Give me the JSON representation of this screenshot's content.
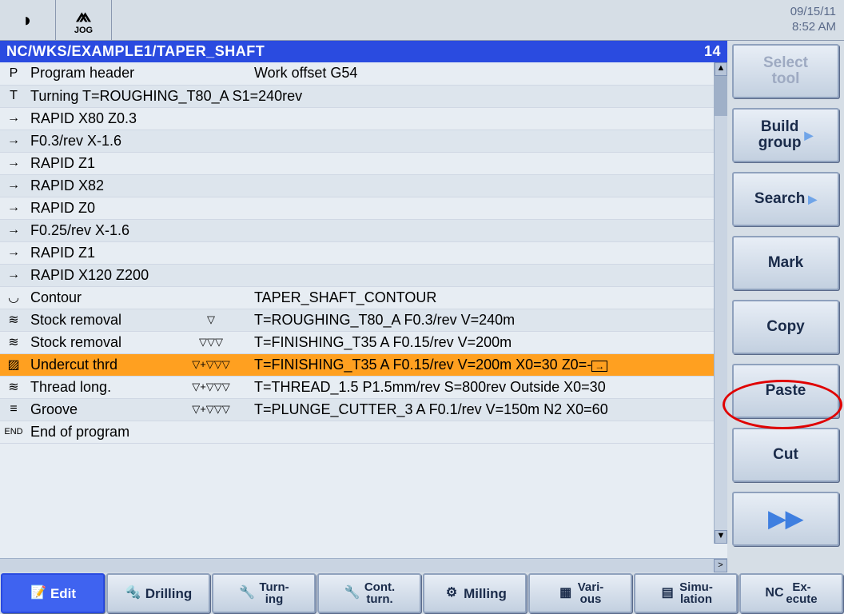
{
  "datetime": {
    "date": "09/15/11",
    "time": "8:52 AM"
  },
  "top": {
    "mode": "JOG"
  },
  "path": {
    "text": "NC/WKS/EXAMPLE1/TAPER_SHAFT",
    "line": "14"
  },
  "program": {
    "rows": [
      {
        "icon": "P",
        "name": "Program header",
        "sym": "",
        "txt": "Work offset G54"
      },
      {
        "icon": "T",
        "name": "Turning T=ROUGHING_T80_A S1=240rev",
        "sym": "",
        "txt": ""
      },
      {
        "icon": "→",
        "name": "RAPID X80 Z0.3",
        "sym": "",
        "txt": ""
      },
      {
        "icon": "→",
        "name": "F0.3/rev X-1.6",
        "sym": "",
        "txt": ""
      },
      {
        "icon": "→",
        "name": "RAPID Z1",
        "sym": "",
        "txt": ""
      },
      {
        "icon": "→",
        "name": "RAPID X82",
        "sym": "",
        "txt": ""
      },
      {
        "icon": "→",
        "name": "RAPID Z0",
        "sym": "",
        "txt": ""
      },
      {
        "icon": "→",
        "name": "F0.25/rev X-1.6",
        "sym": "",
        "txt": ""
      },
      {
        "icon": "→",
        "name": "RAPID Z1",
        "sym": "",
        "txt": ""
      },
      {
        "icon": "→",
        "name": "RAPID X120 Z200",
        "sym": "",
        "txt": ""
      },
      {
        "icon": "◡",
        "name": "Contour",
        "sym": "",
        "txt": "TAPER_SHAFT_CONTOUR"
      },
      {
        "icon": "≋",
        "name": "Stock removal",
        "sym": "▽",
        "txt": "T=ROUGHING_T80_A F0.3/rev V=240m"
      },
      {
        "icon": "≋",
        "name": "Stock removal",
        "sym": "▽▽▽",
        "txt": "T=FINISHING_T35 A F0.15/rev V=200m"
      },
      {
        "icon": "▨",
        "name": "Undercut thrd",
        "sym": "▽+▽▽▽",
        "txt": "T=FINISHING_T35 A F0.15/rev V=200m X0=30 Z0=-",
        "hl": true,
        "arrow": true
      },
      {
        "icon": "≋",
        "name": "Thread long.",
        "sym": "▽+▽▽▽",
        "txt": "T=THREAD_1.5 P1.5mm/rev S=800rev Outside X0=30"
      },
      {
        "icon": "≡",
        "name": "Groove",
        "sym": "▽+▽▽▽",
        "txt": "T=PLUNGE_CUTTER_3 A F0.1/rev V=150m N2 X0=60"
      },
      {
        "icon": "END",
        "name": "End of program",
        "sym": "",
        "txt": ""
      }
    ]
  },
  "soft_right": {
    "select_tool": "Select\ntool",
    "build_group": "Build\ngroup",
    "search": "Search",
    "mark": "Mark",
    "copy": "Copy",
    "paste": "Paste",
    "cut": "Cut",
    "more": "▶▶"
  },
  "soft_bottom": {
    "edit": "Edit",
    "drilling": "Drilling",
    "turning": "Turn-\ning",
    "cont_turn": "Cont.\nturn.",
    "milling": "Milling",
    "various": "Vari-\nous",
    "simulation": "Simu-\nlation",
    "execute": "Ex-\necute"
  }
}
